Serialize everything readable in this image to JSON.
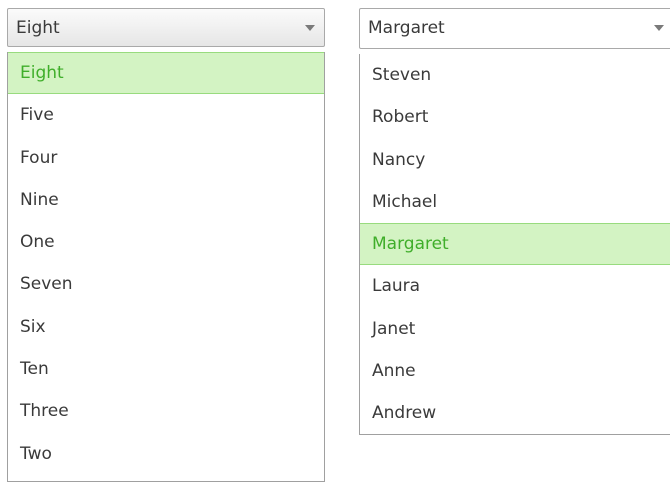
{
  "combo_left": {
    "value": "Eight",
    "options": [
      "Eight",
      "Five",
      "Four",
      "Nine",
      "One",
      "Seven",
      "Six",
      "Ten",
      "Three",
      "Two"
    ],
    "selected_index": 0
  },
  "combo_right": {
    "value": "Margaret",
    "options": [
      "Steven",
      "Robert",
      "Nancy",
      "Michael",
      "Margaret",
      "Laura",
      "Janet",
      "Anne",
      "Andrew"
    ],
    "selected_index": 4
  },
  "colors": {
    "selected_background": "#d3f3c3",
    "selected_text": "#3fae2a",
    "selected_border": "#98db7e"
  },
  "icons": {
    "dropdown_arrow": "chevron-down-icon"
  }
}
